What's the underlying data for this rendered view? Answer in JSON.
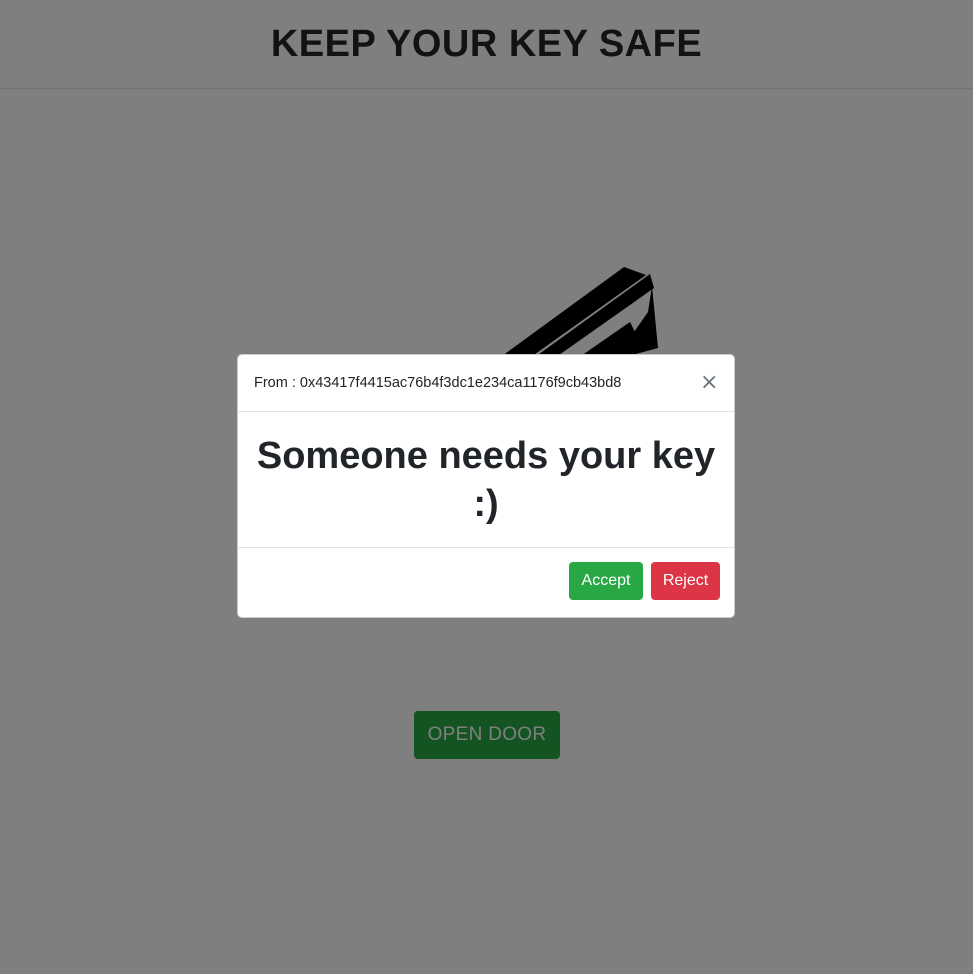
{
  "header": {
    "title": "KEEP YOUR KEY SAFE"
  },
  "main": {
    "open_door_label": "OPEN DOOR"
  },
  "modal": {
    "from_text": "From : 0x43417f4415ac76b4f3dc1e234ca1176f9cb43bd8",
    "close_glyph": "×",
    "message": "Someone needs your key :)",
    "accept_label": "Accept",
    "reject_label": "Reject"
  },
  "colors": {
    "success": "#28a745",
    "danger": "#dc3545",
    "text": "#212529",
    "backdrop": "rgba(0,0,0,0.5)"
  },
  "icons": {
    "key_image": "key-icon",
    "close": "close-icon"
  }
}
